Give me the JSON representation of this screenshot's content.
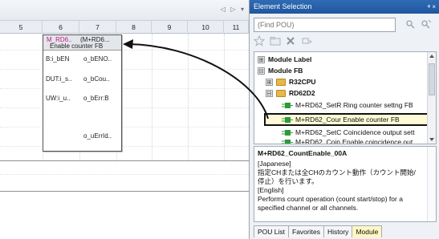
{
  "editor": {
    "columns": [
      "5",
      "6",
      "7",
      "8",
      "9",
      "10",
      "11"
    ],
    "controls": "◁ ▷ ▾",
    "fb": {
      "instance": "M_RD6..",
      "type": "(M+RD6...",
      "comment": "Enable counter FB",
      "inputs": [
        "B:i_bEN",
        "DUT:i_s..",
        "UW:i_u.."
      ],
      "outputs": [
        "o_bENO..",
        "o_bCou..",
        "o_bErr:B",
        "o_uErrId.."
      ]
    }
  },
  "panel": {
    "title": "Element Selection",
    "pin": "ᵠ ×",
    "search_placeholder": "(Find POU)",
    "tree": [
      {
        "label": "Module Label",
        "expander": "⊞"
      },
      {
        "label": "Module FB",
        "expander": "⊟"
      },
      {
        "label": "R32CPU",
        "expander": "⊞"
      },
      {
        "label": "RD62D2",
        "expander": "⊟"
      },
      {
        "label": "M+RD62_SetR  Ring counter settng FB"
      },
      {
        "label": "M+RD62_Cour  Enable counter FB"
      },
      {
        "label": "M+RD62_SetC  Coincidence output sett"
      },
      {
        "label": "M+RD62_Coin  Enable coincidence out"
      }
    ],
    "description": {
      "title": "M+RD62_CountEnable_00A",
      "lines": [
        "[Japanese]",
        "指定CHまたは全CHのカウント動作（カウント開始/",
        "停止）を行います。",
        "[English]",
        "Performs count operation (count start/stop) for a",
        "specified channel or all channels."
      ]
    },
    "tabs": [
      "POU List",
      "Favorites",
      "History",
      "Module"
    ],
    "active_tab": "Module"
  }
}
